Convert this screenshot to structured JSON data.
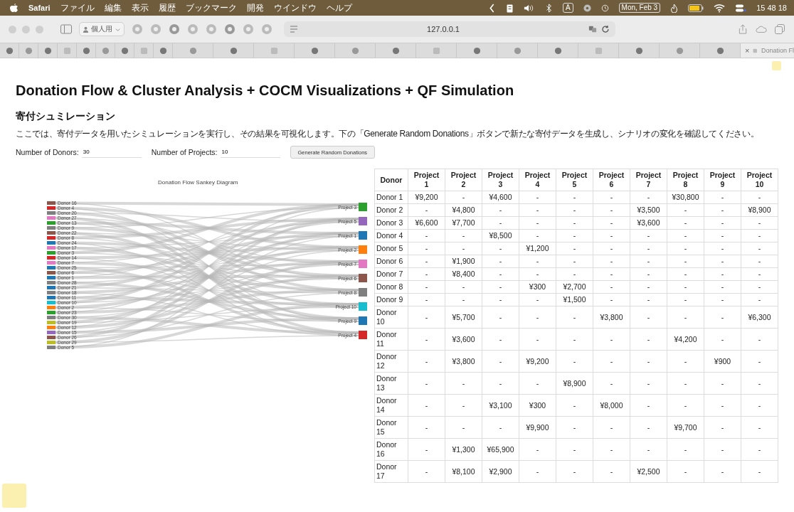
{
  "menu_bar": {
    "app": "Safari",
    "menus": [
      "ファイル",
      "編集",
      "表示",
      "履歴",
      "ブックマーク",
      "開発",
      "ウインドウ",
      "ヘルプ"
    ],
    "input_source": "A",
    "date": "Mon, Feb 3",
    "time": "15 48 18"
  },
  "toolbar": {
    "profile": "個人用",
    "address": "127.0.0.1"
  },
  "tabs": [
    {
      "kind": "pinned",
      "selected": false
    },
    {
      "kind": "pinned",
      "selected": false
    },
    {
      "kind": "pinned",
      "selected": false
    },
    {
      "kind": "pinned",
      "selected": false
    },
    {
      "kind": "pinned",
      "selected": false
    },
    {
      "kind": "pinned",
      "selected": false
    },
    {
      "kind": "pinned",
      "selected": false
    },
    {
      "kind": "pinned",
      "selected": false
    },
    {
      "kind": "pinned",
      "selected": false
    },
    {
      "kind": "normal",
      "selected": false
    },
    {
      "kind": "normal",
      "selected": false
    },
    {
      "kind": "normal",
      "selected": false
    },
    {
      "kind": "normal",
      "selected": false
    },
    {
      "kind": "normal",
      "selected": false
    },
    {
      "kind": "normal",
      "selected": false
    },
    {
      "kind": "normal",
      "selected": false
    },
    {
      "kind": "normal",
      "selected": false
    },
    {
      "kind": "normal",
      "selected": false
    },
    {
      "kind": "normal",
      "selected": false
    },
    {
      "kind": "normal",
      "selected": false
    },
    {
      "kind": "normal",
      "selected": false
    },
    {
      "kind": "normal",
      "selected": false
    },
    {
      "kind": "normal",
      "selected": false
    },
    {
      "kind": "normal",
      "selected": true,
      "close": "×",
      "title": "Donation Fl"
    }
  ],
  "page": {
    "title": "Donation Flow & Cluster Analysis + COCM Visualizations + QF Simulation",
    "section_title": "寄付シュミレーション",
    "intro": "ここでは、寄付データを用いたシミュレーションを実行し、その結果を可視化します。下の「Generate Random Donations」ボタンで新たな寄付データを生成し、シナリオの変化を確認してください。",
    "controls": {
      "donors_label": "Number of Donors:",
      "donors_value": "30",
      "projects_label": "Number of Projects:",
      "projects_value": "10",
      "generate_button": "Generate Random Donations"
    },
    "sankey": {
      "title": "Donation Flow Sankey Diagram",
      "donors": [
        {
          "label": "Donor 16",
          "color": "#8c564b"
        },
        {
          "label": "Donor 4",
          "color": "#d62728"
        },
        {
          "label": "Donor 20",
          "color": "#7f7f7f"
        },
        {
          "label": "Donor 27",
          "color": "#e377c2"
        },
        {
          "label": "Donor 13",
          "color": "#2ca02c"
        },
        {
          "label": "Donor 9",
          "color": "#7f7f7f"
        },
        {
          "label": "Donor 22",
          "color": "#8c564b"
        },
        {
          "label": "Donor 8",
          "color": "#d62728"
        },
        {
          "label": "Donor 24",
          "color": "#1f77b4"
        },
        {
          "label": "Donor 17",
          "color": "#e377c2"
        },
        {
          "label": "Donor 3",
          "color": "#2ca02c"
        },
        {
          "label": "Donor 14",
          "color": "#d62728"
        },
        {
          "label": "Donor 7",
          "color": "#e377c2"
        },
        {
          "label": "Donor 25",
          "color": "#1f77b4"
        },
        {
          "label": "Donor 6",
          "color": "#8c564b"
        },
        {
          "label": "Donor 1",
          "color": "#1f77b4"
        },
        {
          "label": "Donor 28",
          "color": "#7f7f7f"
        },
        {
          "label": "Donor 21",
          "color": "#1f77b4"
        },
        {
          "label": "Donor 18",
          "color": "#7f7f7f"
        },
        {
          "label": "Donor 11",
          "color": "#1f77b4"
        },
        {
          "label": "Donor 10",
          "color": "#17becf"
        },
        {
          "label": "Donor 2",
          "color": "#ff7f0e"
        },
        {
          "label": "Donor 23",
          "color": "#2ca02c"
        },
        {
          "label": "Donor 30",
          "color": "#7f7f7f"
        },
        {
          "label": "Donor 19",
          "color": "#bcbd22"
        },
        {
          "label": "Donor 12",
          "color": "#ff7f0e"
        },
        {
          "label": "Donor 15",
          "color": "#9467bd"
        },
        {
          "label": "Donor 26",
          "color": "#8c564b"
        },
        {
          "label": "Donor 29",
          "color": "#bcbd22"
        },
        {
          "label": "Donor 5",
          "color": "#7f7f7f"
        }
      ],
      "projects": [
        {
          "label": "Project 3",
          "color": "#2ca02c"
        },
        {
          "label": "Project 5",
          "color": "#9467bd"
        },
        {
          "label": "Project 1",
          "color": "#1f77b4"
        },
        {
          "label": "Project 2",
          "color": "#ff7f0e"
        },
        {
          "label": "Project 7",
          "color": "#e377c2"
        },
        {
          "label": "Project 6",
          "color": "#8c564b"
        },
        {
          "label": "Project 8",
          "color": "#7f7f7f"
        },
        {
          "label": "Project 10",
          "color": "#17becf"
        },
        {
          "label": "Project 9",
          "color": "#1f77b4"
        },
        {
          "label": "Project 4",
          "color": "#d62728"
        }
      ]
    },
    "table": {
      "columns": [
        "Donor",
        "Project 1",
        "Project 2",
        "Project 3",
        "Project 4",
        "Project 5",
        "Project 6",
        "Project 7",
        "Project 8",
        "Project 9",
        "Project 10"
      ],
      "rows": [
        {
          "cells": [
            "Donor 1",
            "¥9,200",
            "-",
            "¥4,600",
            "-",
            "-",
            "-",
            "-",
            "¥30,800",
            "-",
            "-"
          ]
        },
        {
          "cells": [
            "Donor 2",
            "-",
            "¥4,800",
            "-",
            "-",
            "-",
            "-",
            "¥3,500",
            "-",
            "-",
            "¥8,900"
          ]
        },
        {
          "cells": [
            "Donor 3",
            "¥6,600",
            "¥7,700",
            "-",
            "-",
            "-",
            "-",
            "¥3,600",
            "-",
            "-",
            "-"
          ]
        },
        {
          "cells": [
            "Donor 4",
            "-",
            "-",
            "¥8,500",
            "-",
            "-",
            "-",
            "-",
            "-",
            "-",
            "-"
          ]
        },
        {
          "cells": [
            "Donor 5",
            "-",
            "-",
            "-",
            "¥1,200",
            "-",
            "-",
            "-",
            "-",
            "-",
            "-"
          ]
        },
        {
          "cells": [
            "Donor 6",
            "-",
            "¥1,900",
            "-",
            "-",
            "-",
            "-",
            "-",
            "-",
            "-",
            "-"
          ]
        },
        {
          "cells": [
            "Donor 7",
            "-",
            "¥8,400",
            "-",
            "-",
            "-",
            "-",
            "-",
            "-",
            "-",
            "-"
          ]
        },
        {
          "cells": [
            "Donor 8",
            "-",
            "-",
            "-",
            "¥300",
            "¥2,700",
            "-",
            "-",
            "-",
            "-",
            "-"
          ]
        },
        {
          "cells": [
            "Donor 9",
            "-",
            "-",
            "-",
            "-",
            "¥1,500",
            "-",
            "-",
            "-",
            "-",
            "-"
          ]
        },
        {
          "cells": [
            "Donor 10",
            "-",
            "¥5,700",
            "-",
            "-",
            "-",
            "¥3,800",
            "-",
            "-",
            "-",
            "¥6,300"
          ]
        },
        {
          "cells": [
            "Donor 11",
            "-",
            "¥3,600",
            "-",
            "-",
            "-",
            "-",
            "-",
            "¥4,200",
            "-",
            "-"
          ]
        },
        {
          "cells": [
            "Donor 12",
            "-",
            "¥3,800",
            "-",
            "¥9,200",
            "-",
            "-",
            "-",
            "-",
            "¥900",
            "-"
          ]
        },
        {
          "cells": [
            "Donor 13",
            "-",
            "-",
            "-",
            "-",
            "¥8,900",
            "-",
            "-",
            "-",
            "-",
            "-"
          ]
        },
        {
          "cells": [
            "Donor 14",
            "-",
            "-",
            "¥3,100",
            "¥300",
            "-",
            "¥8,000",
            "-",
            "-",
            "-",
            "-"
          ]
        },
        {
          "cells": [
            "Donor 15",
            "-",
            "-",
            "-",
            "¥9,900",
            "-",
            "-",
            "-",
            "¥9,700",
            "-",
            "-"
          ]
        },
        {
          "cells": [
            "Donor 16",
            "-",
            "¥1,300",
            "¥65,900",
            "-",
            "-",
            "-",
            "-",
            "-",
            "-",
            "-"
          ]
        },
        {
          "cells": [
            "Donor 17",
            "-",
            "¥8,100",
            "¥2,900",
            "-",
            "-",
            "-",
            "¥2,500",
            "-",
            "-",
            "-"
          ]
        }
      ]
    }
  }
}
